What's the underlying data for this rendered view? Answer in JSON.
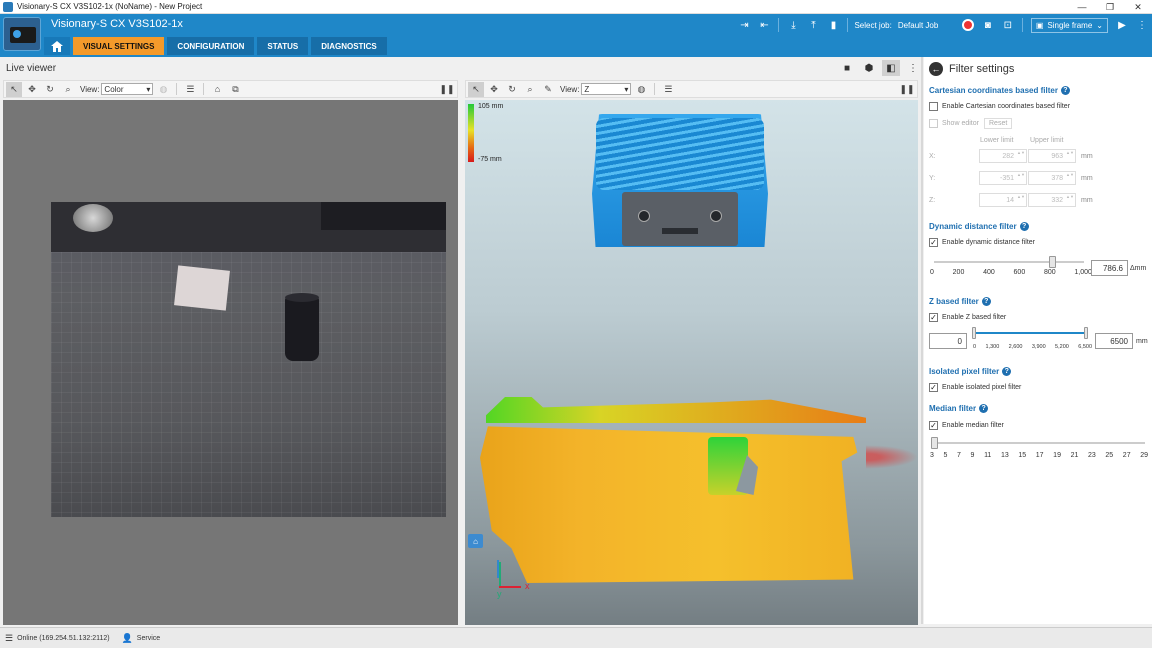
{
  "window": {
    "title": "Visionary-S CX V3S102-1x (NoName) - New Project",
    "controls": [
      "—",
      "❐",
      "✕"
    ]
  },
  "header": {
    "device_name": "Visionary-S CX V3S102-1x",
    "tabs": [
      {
        "label": "VISUAL SETTINGS",
        "active": true
      },
      {
        "label": "CONFIGURATION",
        "active": false
      },
      {
        "label": "STATUS",
        "active": false
      },
      {
        "label": "DIAGNOSTICS",
        "active": false
      }
    ],
    "select_job_label": "Select job:",
    "job_value": "Default Job",
    "frame_mode": "Single frame",
    "accent_color": "#1f87c8",
    "active_tab_color": "#f39a2b"
  },
  "live_viewer": {
    "title": "Live viewer"
  },
  "left_view": {
    "view_label": "View:",
    "view_value": "Color"
  },
  "right_view": {
    "view_label": "View:",
    "view_value": "Z",
    "colorbar_max": "105 mm",
    "colorbar_min": "-75 mm",
    "axis_x": "x",
    "axis_y": "y"
  },
  "filter_settings": {
    "title": "Filter settings",
    "cartesian": {
      "title": "Cartesian coordinates based filter",
      "enable_label": "Enable Cartesian coordinates based filter",
      "enabled": false,
      "show_editor_label": "Show editor",
      "reset_label": "Reset",
      "lower_limit_label": "Lower limit",
      "upper_limit_label": "Upper limit",
      "rows": [
        {
          "axis": "X:",
          "lower": "282",
          "upper": "963",
          "unit": "mm"
        },
        {
          "axis": "Y:",
          "lower": "-351",
          "upper": "378",
          "unit": "mm"
        },
        {
          "axis": "Z:",
          "lower": "14",
          "upper": "332",
          "unit": "mm"
        }
      ]
    },
    "dynamic": {
      "title": "Dynamic distance filter",
      "enable_label": "Enable dynamic distance filter",
      "enabled": true,
      "ticks": [
        "0",
        "200",
        "400",
        "600",
        "800",
        "1,000"
      ],
      "value": "786.6",
      "value_fraction": 0.7866,
      "unit": "Δmm"
    },
    "z_based": {
      "title": "Z based filter",
      "enable_label": "Enable Z based filter",
      "enabled": true,
      "min_value": "0",
      "max_value": "6500",
      "ticks": [
        "0",
        "1,300",
        "2,600",
        "3,900",
        "5,200",
        "6,500"
      ],
      "unit": "mm"
    },
    "isolated": {
      "title": "Isolated pixel filter",
      "enable_label": "Enable isolated pixel filter",
      "enabled": true
    },
    "median": {
      "title": "Median filter",
      "enable_label": "Enable median filter",
      "enabled": true,
      "ticks": [
        "3",
        "5",
        "7",
        "9",
        "11",
        "13",
        "15",
        "17",
        "19",
        "21",
        "23",
        "25",
        "27",
        "29"
      ]
    }
  },
  "statusbar": {
    "connection": "Online (169.254.51.132:2112)",
    "user": "Service"
  }
}
